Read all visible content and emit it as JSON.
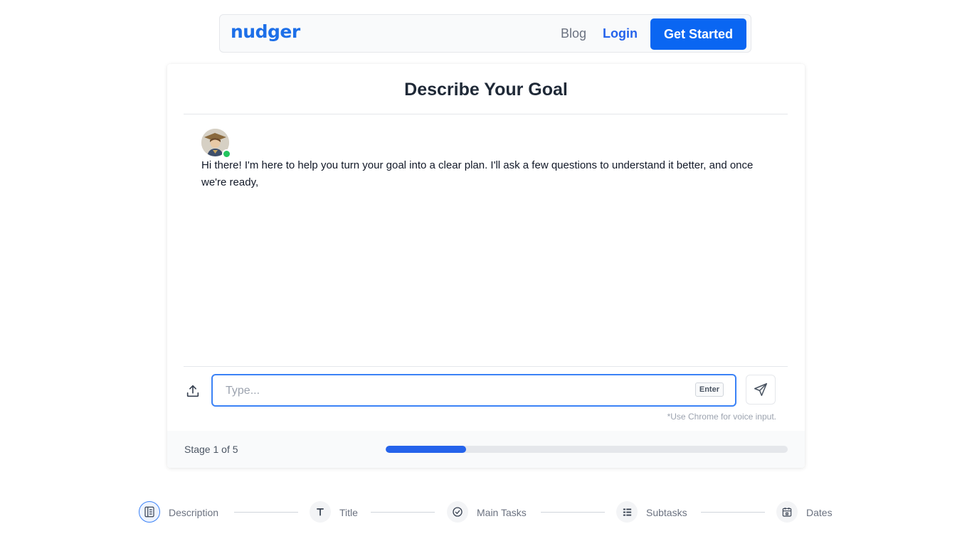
{
  "nav": {
    "logo": "nudger",
    "blog": "Blog",
    "login": "Login",
    "cta": "Get Started"
  },
  "chat": {
    "title": "Describe Your Goal",
    "bot_message": "Hi there!    I'm here to help you turn your goal into a clear plan. I'll ask a few questions to understand it better, and once we're ready,",
    "input_placeholder": "Type...",
    "enter_hint": "Enter",
    "voice_note": "*Use Chrome for voice input."
  },
  "progress": {
    "stage_label": "Stage 1 of 5",
    "fraction": 0.2
  },
  "steps": [
    {
      "label": "Description",
      "icon": "description-icon",
      "active": true
    },
    {
      "label": "Title",
      "icon": "title-icon",
      "active": false
    },
    {
      "label": "Main Tasks",
      "icon": "check-circle-icon",
      "active": false
    },
    {
      "label": "Subtasks",
      "icon": "list-icon",
      "active": false
    },
    {
      "label": "Dates",
      "icon": "calendar-icon",
      "active": false
    }
  ],
  "colors": {
    "accent": "#0a66f2",
    "progress": "#2563eb",
    "online": "#22c55e"
  }
}
